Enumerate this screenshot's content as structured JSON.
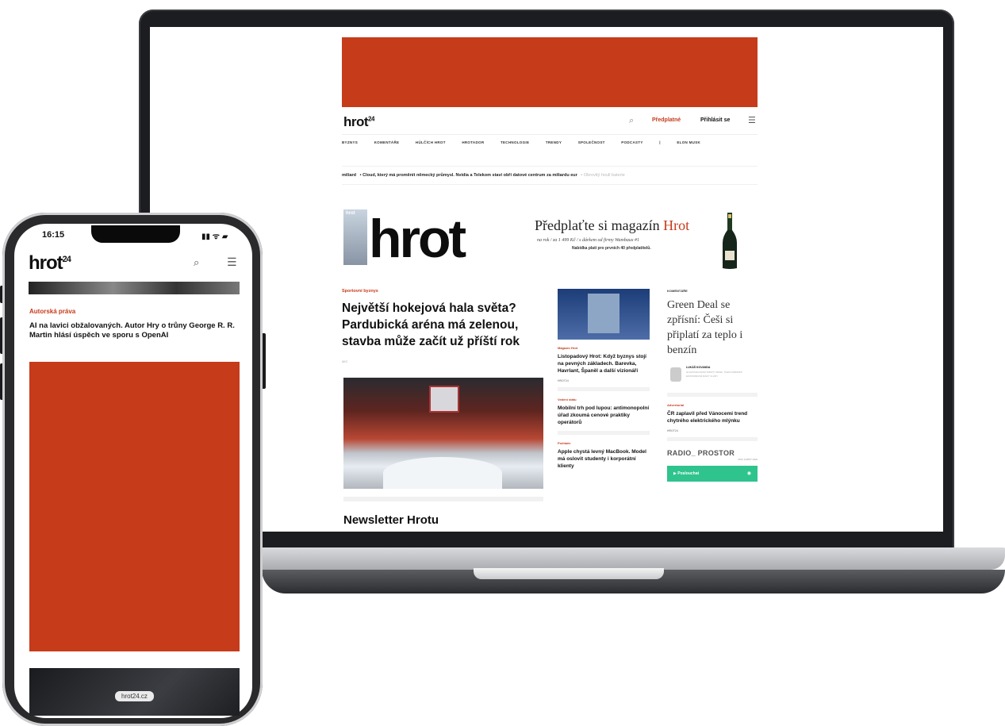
{
  "laptop": {
    "header": {
      "logo_text": "hrot",
      "logo_sup": "24",
      "search_icon": "⌕",
      "subscribe_label": "Předplatné",
      "login_label": "Přihlásit se",
      "menu_icon": "☰"
    },
    "nav_items": [
      "BYZNYS",
      "KOMENTÁŘE",
      "HŮLČÍCH HROT",
      "HROTADOR",
      "TECHNOLOGIE",
      "TRENDY",
      "SPOLEČNOST",
      "PODCASTY",
      "|",
      "ELON MUSK"
    ],
    "ticker": {
      "lead": "miliard",
      "text": "•   Cloud, který má proměnit německý průmysl. Nvidia a Telekom staví obří datové centrum za miliardu eur",
      "muted": "•   Obrovitý houll baterie"
    },
    "promo": {
      "cover_text": "hrot",
      "logo_text": "hrot",
      "title_prefix": "Předplaťte si magazín",
      "title_accent": "Hrot",
      "offer_line": "na rok / za 1 499 Kč / s dárkem od firmy Wambaux #1",
      "note": "Nabídka platí pro prvních 40 předplatitelů."
    },
    "main_article": {
      "kicker": "Sportovní byznys",
      "headline": "Největší hokejová hala světa? Pardubická aréna má zelenou, stavba může začít už příští rok",
      "meta": "MIC"
    },
    "newsletter_title": "Newsletter Hrotu",
    "col2": [
      {
        "kicker": "Magazín Hrot",
        "headline": "Listopadový Hrot: Když byznys stojí na pevných základech. Barevka, Havrlant, Španěl a další vizionáři",
        "tag": "HROT24"
      },
      {
        "kicker": "Vedení státu",
        "headline": "Mobilní trh pod lupou: antimonopolní úřad zkoumá cenové praktiky operátorů",
        "tag": ""
      },
      {
        "kicker": "Počítače",
        "headline": "Apple chystá levný MacBook. Model má oslovit studenty i korporátní klienty",
        "tag": ""
      }
    ],
    "col3": {
      "kicker": "KOMENTÁŘE",
      "headline": "Green Deal se zpřísní: Češi si připlatí za teplo i benzín",
      "author_name": "LUKÁŠ KOVANDA",
      "author_desc": "HLAVNÍ EKONOM TRINITY BANK, ČLEN NÁRODNÍ EKONOMICKÉ RADY VLÁDY",
      "item2_kicker": "Advertorial",
      "item2_headline": "ČR zaplavil před Vánocemi trend chytrého elektrického mlýnku",
      "item2_tag": "HROT24",
      "radio_name": "RADIO_ PROSTOR",
      "radio_sub": "PRO KAŽDÝ DEN",
      "radio_button": "▶  Poslouchat"
    }
  },
  "phone": {
    "time": "16:15",
    "status_icons": "▮▮ ᯤ ▰",
    "logo_text": "hrot",
    "logo_sup": "24",
    "search_icon": "⌕",
    "menu_icon": "☰",
    "kicker": "Autorská práva",
    "headline": "AI na lavici obžalovaných. Autor Hry o trůny George R. R. Martin hlásí úspěch ve sporu s OpenAI",
    "bottom_url": "hrot24.cz"
  },
  "colors": {
    "accent": "#c63b1a",
    "radio_green": "#2fc38e",
    "device_dark": "#1c1d20"
  }
}
